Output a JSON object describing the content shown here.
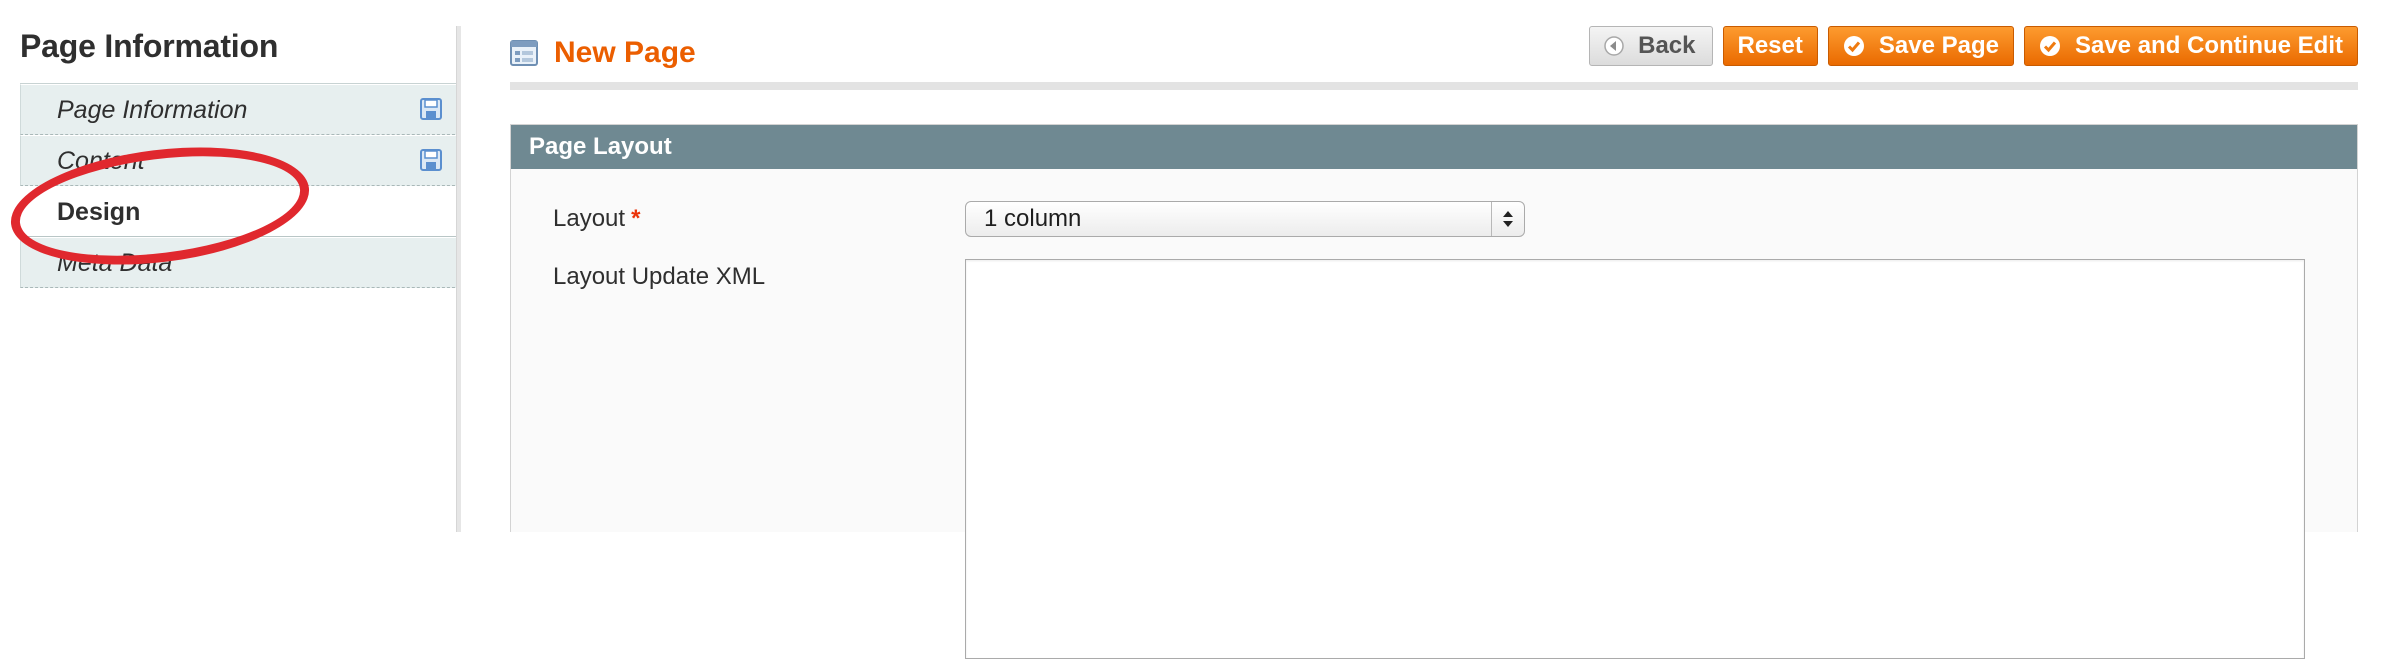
{
  "sidebar": {
    "title": "Page Information",
    "tabs": [
      {
        "label": "Page Information"
      },
      {
        "label": "Content"
      },
      {
        "label": "Design"
      },
      {
        "label": "Meta Data"
      }
    ]
  },
  "header": {
    "title": "New Page",
    "buttons": {
      "back": "Back",
      "reset": "Reset",
      "save": "Save Page",
      "save_continue": "Save and Continue Edit"
    }
  },
  "fieldset": {
    "title": "Page Layout",
    "layout_label": "Layout",
    "required_mark": "*",
    "layout_value": "1 column",
    "xml_label": "Layout Update XML",
    "xml_value": ""
  },
  "colors": {
    "accent": "#eb5e00",
    "button_orange": "#f07800",
    "fieldset_header": "#6f8992",
    "annotation": "#e0282e"
  },
  "icons": [
    "save-icon",
    "page-icon",
    "back-arrow-icon",
    "checkmark-icon",
    "select-updown-icon"
  ]
}
